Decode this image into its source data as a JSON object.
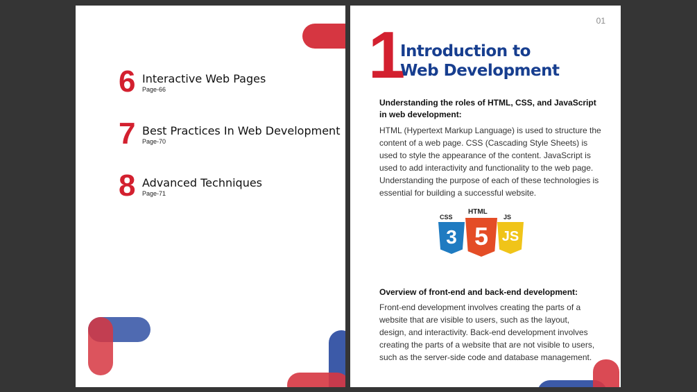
{
  "left_page": {
    "toc": [
      {
        "number": "6",
        "title": "Interactive Web Pages",
        "page": "Page-66"
      },
      {
        "number": "7",
        "title": "Best Practices In Web Development",
        "page": "Page-70"
      },
      {
        "number": "8",
        "title": "Advanced Techniques",
        "page": "Page-71"
      }
    ]
  },
  "right_page": {
    "page_number": "01",
    "chapter_number": "1",
    "chapter_title_line1": "Introduction to",
    "chapter_title_line2": "Web Development",
    "section1": {
      "heading_line1": "Understanding the roles of HTML, CSS, and JavaScript",
      "heading_line2": "in web development:",
      "body": "HTML (Hypertext Markup Language) is used to structure the content of a web page. CSS (Cascading Style Sheets) is used to style the appearance of the content. JavaScript is used to add interactivity and functionality to the web page. Understanding the purpose of each of these technologies is essential for building a successful website."
    },
    "logos": {
      "css_label": "CSS",
      "html_label": "HTML",
      "js_label": "JS",
      "css_glyph": "3",
      "html_glyph": "5",
      "js_glyph": "JS",
      "css_color": "#1f7bc1",
      "html_color": "#e44d26",
      "js_color": "#f0c419"
    },
    "section2": {
      "heading": "Overview of front-end and back-end development:",
      "body": "Front-end development involves creating the parts of a website that are visible to users, such as the layout, design, and interactivity. Back-end development involves creating the parts of a website that are not visible to users, such as the server-side code and database management."
    }
  },
  "colors": {
    "accent_red": "#d3202f",
    "accent_blue": "#173e8f",
    "background": "#353535"
  }
}
